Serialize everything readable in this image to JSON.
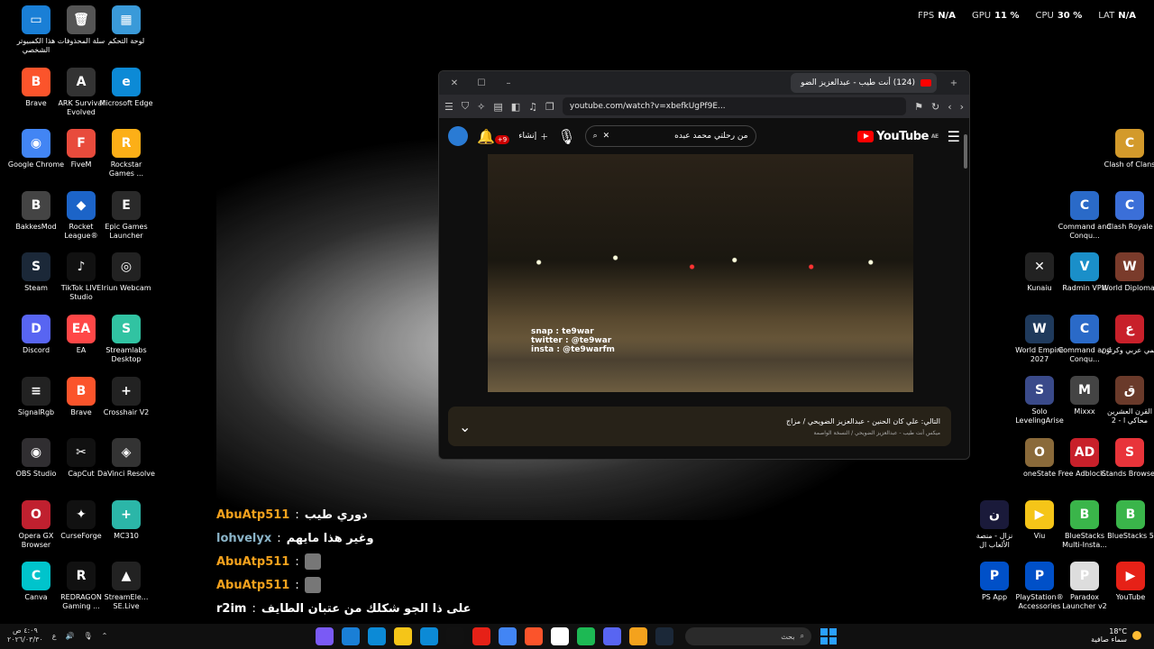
{
  "perf": [
    {
      "label": "FPS",
      "value": "N/A"
    },
    {
      "label": "GPU",
      "value": "11 %"
    },
    {
      "label": "CPU",
      "value": "30 %"
    },
    {
      "label": "LAT",
      "value": "N/A"
    }
  ],
  "desktop_left": [
    {
      "label": "هذا الكمبيوتر الشخصي",
      "color": "#1a7fd6",
      "glyph": "▭"
    },
    {
      "label": "سلة المحذوفات",
      "color": "#555",
      "glyph": "🗑"
    },
    {
      "label": "لوحة التحكم",
      "color": "#3a9ad9",
      "glyph": "▦"
    },
    {
      "label": "Brave",
      "color": "#fb542b",
      "glyph": "B"
    },
    {
      "label": "ARK Survival Evolved",
      "color": "#333",
      "glyph": "A"
    },
    {
      "label": "Microsoft Edge",
      "color": "#0c8ad6",
      "glyph": "e"
    },
    {
      "label": "Google Chrome",
      "color": "#4285f4",
      "glyph": "◉"
    },
    {
      "label": "FiveM",
      "color": "#e84b3c",
      "glyph": "F"
    },
    {
      "label": "Rockstar Games ...",
      "color": "#fcaf17",
      "glyph": "R"
    },
    {
      "label": "BakkesMod",
      "color": "#444",
      "glyph": "B"
    },
    {
      "label": "Rocket League®",
      "color": "#1c64c8",
      "glyph": "◆"
    },
    {
      "label": "Epic Games Launcher",
      "color": "#2a2a2a",
      "glyph": "E"
    },
    {
      "label": "Steam",
      "color": "#1b2838",
      "glyph": "S"
    },
    {
      "label": "TikTok LIVE Studio",
      "color": "#111",
      "glyph": "♪"
    },
    {
      "label": "Iriun Webcam",
      "color": "#222",
      "glyph": "◎"
    },
    {
      "label": "Discord",
      "color": "#5865f2",
      "glyph": "D"
    },
    {
      "label": "EA",
      "color": "#ff4747",
      "glyph": "EA"
    },
    {
      "label": "Streamlabs Desktop",
      "color": "#31c3a2",
      "glyph": "S"
    },
    {
      "label": "SignalRgb",
      "color": "#222",
      "glyph": "≡"
    },
    {
      "label": "Brave",
      "color": "#fb542b",
      "glyph": "B"
    },
    {
      "label": "Crosshair V2",
      "color": "#222",
      "glyph": "+"
    },
    {
      "label": "OBS Studio",
      "color": "#302e31",
      "glyph": "◉"
    },
    {
      "label": "CapCut",
      "color": "#111",
      "glyph": "✂"
    },
    {
      "label": "DaVinci Resolve",
      "color": "#333",
      "glyph": "◈"
    },
    {
      "label": "Opera GX Browser",
      "color": "#c0202f",
      "glyph": "O"
    },
    {
      "label": "CurseForge",
      "color": "#111",
      "glyph": "✦"
    },
    {
      "label": "MC310",
      "color": "#2bb6a8",
      "glyph": "+"
    },
    {
      "label": "Canva",
      "color": "#00c4cc",
      "glyph": "C"
    },
    {
      "label": "REDRAGON Gaming ...",
      "color": "#111",
      "glyph": "R"
    },
    {
      "label": "StreamEle... SE.Live",
      "color": "#222",
      "glyph": "▲"
    }
  ],
  "desktop_right": [
    {
      "label": "Clash of Clans",
      "color": "#d39a2b",
      "glyph": "C"
    },
    {
      "label": "Command and Conqu...",
      "color": "#2a6ac8",
      "glyph": "C"
    },
    {
      "label": "Clash Royale",
      "color": "#3b6fd8",
      "glyph": "C"
    },
    {
      "label": "Kunaiu",
      "color": "#222",
      "glyph": "✕"
    },
    {
      "label": "Radmin VPN",
      "color": "#1a8fc9",
      "glyph": "V"
    },
    {
      "label": "World Diplomat",
      "color": "#7a3b2b",
      "glyph": "W"
    },
    {
      "label": "World Empire 2027",
      "color": "#1f3a5c",
      "glyph": "W"
    },
    {
      "label": "Command and Conqu...",
      "color": "#2a6ac8",
      "glyph": "C"
    },
    {
      "label": "انمي عربي وكرتون",
      "color": "#c8202a",
      "glyph": "ع"
    },
    {
      "label": "Solo LevelingArise",
      "color": "#3a4a8a",
      "glyph": "S"
    },
    {
      "label": "Mixxx",
      "color": "#444",
      "glyph": "M"
    },
    {
      "label": "القرن العشرين محاكي ا - 2",
      "color": "#6a3a2a",
      "glyph": "ق"
    },
    {
      "label": "oneState",
      "color": "#8a6a3a",
      "glyph": "O"
    },
    {
      "label": "Free Adblock...",
      "color": "#c8202a",
      "glyph": "AD"
    },
    {
      "label": "Stands Browser",
      "color": "#e8343a",
      "glyph": "S"
    },
    {
      "label": "نزال - منصة الألعاب ال",
      "color": "#1a1a3a",
      "glyph": "ن"
    },
    {
      "label": "Viu",
      "color": "#f5c518",
      "glyph": "▶"
    },
    {
      "label": "BlueStacks Multi-Insta...",
      "color": "#3ab54a",
      "glyph": "B"
    },
    {
      "label": "BlueStacks 5",
      "color": "#3ab54a",
      "glyph": "B"
    },
    {
      "label": "PS App",
      "color": "#0050c8",
      "glyph": "P"
    },
    {
      "label": "PlayStation® Accessories",
      "color": "#0050c8",
      "glyph": "P"
    },
    {
      "label": "Paradox Launcher v2",
      "color": "#ddd",
      "glyph": "P"
    },
    {
      "label": "YouTube",
      "color": "#e62117",
      "glyph": "▶"
    }
  ],
  "browser": {
    "tab_title": "(124) أنت طيب - عبدالعزيز الضو",
    "url": "youtube.com/watch?v=xbefkUgPf9E...",
    "search_query": "من رحلتي محمد عبده",
    "notif_count": "+9",
    "create_label": "إنشاء",
    "logo_text": "YouTube",
    "logo_region": "AE",
    "video_overlay": [
      "snap : te9war",
      "twitter : @te9war",
      "insta : @te9warfm"
    ],
    "up_next_title": "التالي: علي كان الحنين - عبدالعزيز الضويحي / مزاج",
    "up_next_sub": "ميكس أنت طيب - عبدالعزيز الضويحي / النسخة الواصمة"
  },
  "chat": [
    {
      "user": "AbuAtp511",
      "color": "#f4a21d",
      "msg": "دوري طيب",
      "emote": false
    },
    {
      "user": "lohvelyx",
      "color": "#8ab4c8",
      "msg": "وغير هذا مايهم",
      "emote": false
    },
    {
      "user": "AbuAtp511",
      "color": "#f4a21d",
      "msg": "",
      "emote": true
    },
    {
      "user": "AbuAtp511",
      "color": "#f4a21d",
      "msg": "",
      "emote": true
    },
    {
      "user": "r2im",
      "color": "#ffffff",
      "msg": "على ذا الجو شكلك من عتبان الطايف",
      "emote": false
    }
  ],
  "taskbar": {
    "time": "٤:٠٩ ص",
    "date": "٢٠٢٦/٠٣/٣٠",
    "search_placeholder": "بحث",
    "lang": "ع",
    "weather_temp": "18°C",
    "weather_desc": "سماء صافية",
    "apps": [
      "#1b2838",
      "#f4a21d",
      "#5865f2",
      "#1db954",
      "#fff",
      "#fb542b",
      "#4285f4",
      "#e62117",
      "#111",
      "#0c8ad6",
      "#f5c518",
      "#0c8ad6",
      "#1a7fd6",
      "#7a5af5"
    ]
  }
}
